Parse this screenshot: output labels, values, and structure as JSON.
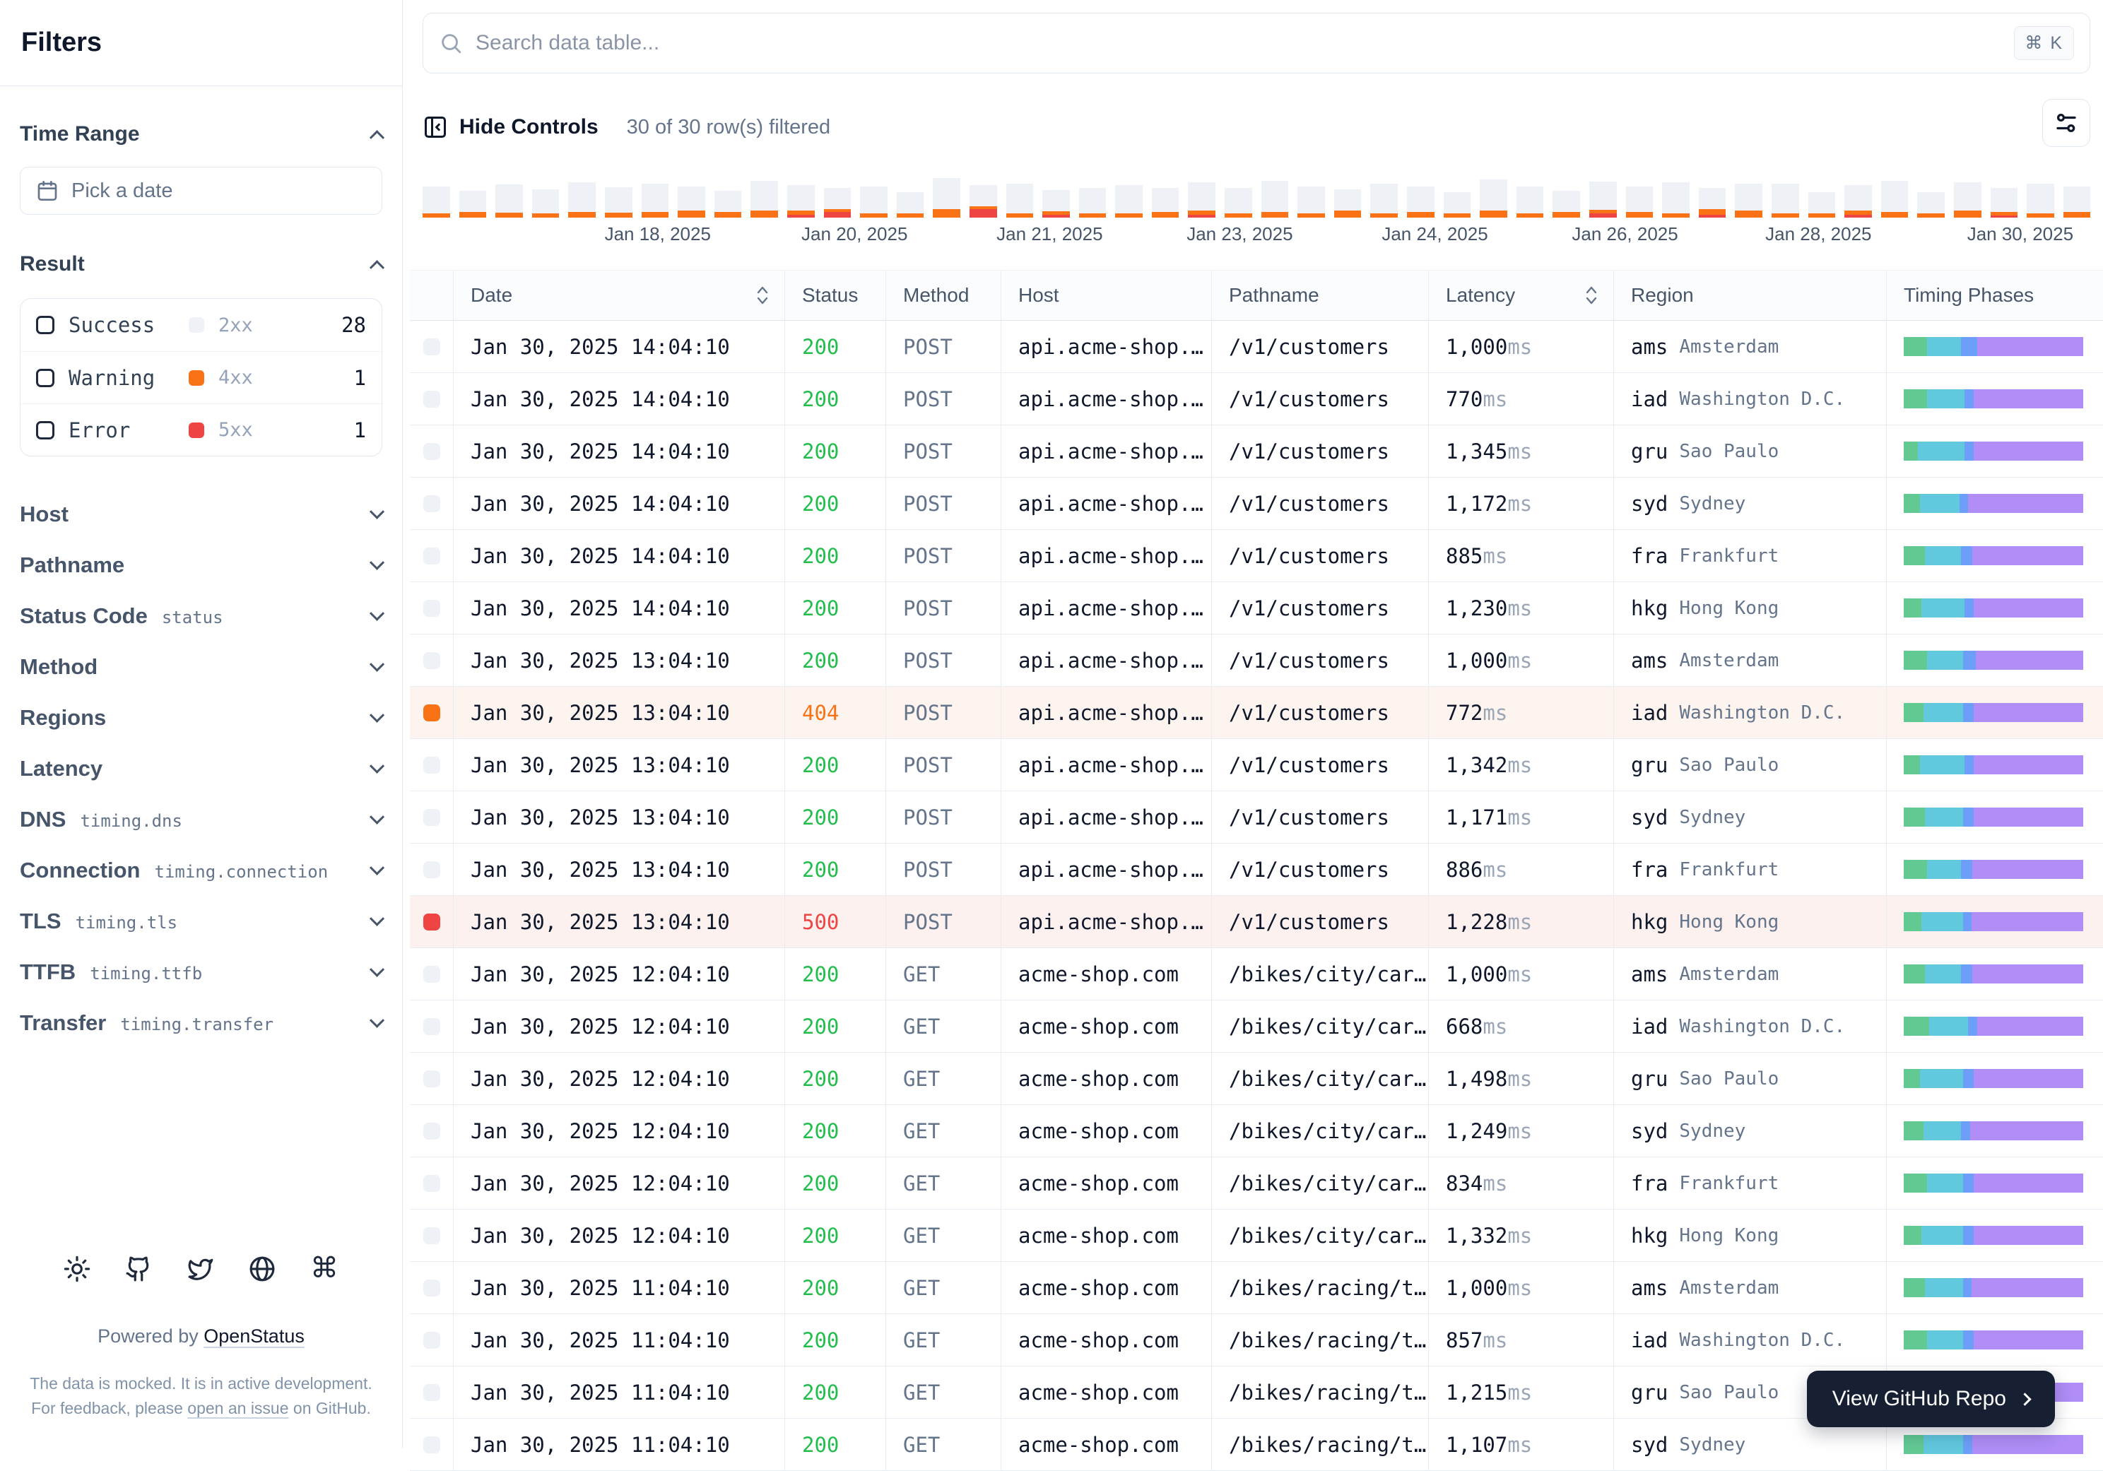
{
  "colors": {
    "accent_orange": "#f97316",
    "accent_red": "#ef4444",
    "success_green": "#23bd4e",
    "bar_gray": "#eef2f6",
    "timing_dns": "#62c993",
    "timing_connection": "#62c8dd",
    "timing_tls": "#6d9ff8",
    "timing_ttfb": "#b08df7",
    "warn_row_bg": "#fdf3ef",
    "err_row_bg": "#fdf1f0"
  },
  "sidebar": {
    "title": "Filters",
    "time_range": {
      "label": "Time Range",
      "picker_label": "Pick a date"
    },
    "result": {
      "label": "Result",
      "options": [
        {
          "label": "Success",
          "code": "2xx",
          "count": "28",
          "color": "#eef2f6"
        },
        {
          "label": "Warning",
          "code": "4xx",
          "count": "1",
          "color": "#f97316"
        },
        {
          "label": "Error",
          "code": "5xx",
          "count": "1",
          "color": "#ef4444"
        }
      ]
    },
    "filters": [
      {
        "label": "Host",
        "code": ""
      },
      {
        "label": "Pathname",
        "code": ""
      },
      {
        "label": "Status Code",
        "code": "status"
      },
      {
        "label": "Method",
        "code": ""
      },
      {
        "label": "Regions",
        "code": ""
      },
      {
        "label": "Latency",
        "code": ""
      },
      {
        "label": "DNS",
        "code": "timing.dns"
      },
      {
        "label": "Connection",
        "code": "timing.connection"
      },
      {
        "label": "TLS",
        "code": "timing.tls"
      },
      {
        "label": "TTFB",
        "code": "timing.ttfb"
      },
      {
        "label": "Transfer",
        "code": "timing.transfer"
      }
    ],
    "footer": {
      "icons": [
        "sun-icon",
        "github-icon",
        "twitter-icon",
        "globe-icon",
        "command-icon"
      ],
      "powered_by": "Powered by",
      "brand_link": "OpenStatus",
      "note_before": "The data is mocked. It is in active development. For feedback, please ",
      "note_link": "open an issue",
      "note_after": " on GitHub."
    }
  },
  "search": {
    "placeholder": "Search data table...",
    "shortcut": "⌘ K"
  },
  "controls": {
    "hide_label": "Hide Controls",
    "filtered_text": "30 of 30 row(s) filtered"
  },
  "chart_data": {
    "type": "bar",
    "stacked": true,
    "title": "Requests over time histogram",
    "legend_position": "none",
    "grid": false,
    "x_ticks": [
      "Jan 18, 2025",
      "Jan 20, 2025",
      "Jan 21, 2025",
      "Jan 23, 2025",
      "Jan 24, 2025",
      "Jan 26, 2025",
      "Jan 28, 2025",
      "Jan 30, 2025"
    ],
    "tick_pos_pct": [
      14.1,
      25.9,
      37.6,
      49.0,
      60.7,
      72.1,
      83.7,
      95.8
    ],
    "series_names": [
      "success_gray",
      "4xx_orange",
      "5xx_red"
    ],
    "bars": [
      [
        38,
        6,
        0
      ],
      [
        30,
        8,
        0
      ],
      [
        40,
        7,
        0
      ],
      [
        34,
        6,
        0
      ],
      [
        42,
        8,
        0
      ],
      [
        36,
        7,
        0
      ],
      [
        40,
        8,
        0
      ],
      [
        34,
        10,
        0
      ],
      [
        30,
        8,
        0
      ],
      [
        42,
        10,
        0
      ],
      [
        36,
        6,
        4
      ],
      [
        30,
        4,
        8
      ],
      [
        38,
        6,
        0
      ],
      [
        30,
        6,
        0
      ],
      [
        44,
        12,
        0
      ],
      [
        30,
        4,
        12
      ],
      [
        42,
        6,
        0
      ],
      [
        30,
        5,
        4
      ],
      [
        36,
        6,
        0
      ],
      [
        40,
        6,
        0
      ],
      [
        34,
        8,
        0
      ],
      [
        40,
        6,
        4
      ],
      [
        36,
        6,
        0
      ],
      [
        44,
        8,
        0
      ],
      [
        38,
        6,
        0
      ],
      [
        30,
        10,
        0
      ],
      [
        42,
        6,
        0
      ],
      [
        36,
        8,
        0
      ],
      [
        30,
        6,
        0
      ],
      [
        44,
        10,
        0
      ],
      [
        38,
        6,
        0
      ],
      [
        30,
        8,
        0
      ],
      [
        40,
        5,
        6
      ],
      [
        36,
        8,
        0
      ],
      [
        44,
        6,
        0
      ],
      [
        30,
        8,
        4
      ],
      [
        38,
        10,
        0
      ],
      [
        42,
        6,
        0
      ],
      [
        30,
        6,
        0
      ],
      [
        36,
        6,
        4
      ],
      [
        44,
        8,
        0
      ],
      [
        30,
        6,
        0
      ],
      [
        40,
        10,
        0
      ],
      [
        34,
        5,
        3
      ],
      [
        42,
        6,
        0
      ],
      [
        36,
        8,
        0
      ]
    ]
  },
  "table": {
    "columns": [
      {
        "label": "",
        "sortable": false
      },
      {
        "label": "Date",
        "sortable": true
      },
      {
        "label": "Status",
        "sortable": false
      },
      {
        "label": "Method",
        "sortable": false
      },
      {
        "label": "Host",
        "sortable": false
      },
      {
        "label": "Pathname",
        "sortable": false
      },
      {
        "label": "Latency",
        "sortable": true
      },
      {
        "label": "Region",
        "sortable": false
      },
      {
        "label": "Timing Phases",
        "sortable": false
      }
    ],
    "latency_unit": "ms",
    "rows": [
      {
        "date": "Jan 30, 2025 14:04:10",
        "status": "200",
        "level": "ok",
        "method": "POST",
        "host": "api.acme-shop.…",
        "pathname": "/v1/customers",
        "latency": "1,000",
        "region_code": "ams",
        "region_city": "Amsterdam",
        "timing": [
          13,
          19,
          9,
          59
        ]
      },
      {
        "date": "Jan 30, 2025 14:04:10",
        "status": "200",
        "level": "ok",
        "method": "POST",
        "host": "api.acme-shop.…",
        "pathname": "/v1/customers",
        "latency": "770",
        "region_code": "iad",
        "region_city": "Washington D.C.",
        "timing": [
          13,
          21,
          5,
          61
        ]
      },
      {
        "date": "Jan 30, 2025 14:04:10",
        "status": "200",
        "level": "ok",
        "method": "POST",
        "host": "api.acme-shop.…",
        "pathname": "/v1/customers",
        "latency": "1,345",
        "region_code": "gru",
        "region_city": "Sao Paulo",
        "timing": [
          8,
          26,
          5,
          61
        ]
      },
      {
        "date": "Jan 30, 2025 14:04:10",
        "status": "200",
        "level": "ok",
        "method": "POST",
        "host": "api.acme-shop.…",
        "pathname": "/v1/customers",
        "latency": "1,172",
        "region_code": "syd",
        "region_city": "Sydney",
        "timing": [
          9,
          22,
          5,
          64
        ]
      },
      {
        "date": "Jan 30, 2025 14:04:10",
        "status": "200",
        "level": "ok",
        "method": "POST",
        "host": "api.acme-shop.…",
        "pathname": "/v1/customers",
        "latency": "885",
        "region_code": "fra",
        "region_city": "Frankfurt",
        "timing": [
          12,
          20,
          6,
          62
        ]
      },
      {
        "date": "Jan 30, 2025 14:04:10",
        "status": "200",
        "level": "ok",
        "method": "POST",
        "host": "api.acme-shop.…",
        "pathname": "/v1/customers",
        "latency": "1,230",
        "region_code": "hkg",
        "region_city": "Hong Kong",
        "timing": [
          10,
          24,
          5,
          61
        ]
      },
      {
        "date": "Jan 30, 2025 13:04:10",
        "status": "200",
        "level": "ok",
        "method": "POST",
        "host": "api.acme-shop.…",
        "pathname": "/v1/customers",
        "latency": "1,000",
        "region_code": "ams",
        "region_city": "Amsterdam",
        "timing": [
          13,
          20,
          7,
          60
        ]
      },
      {
        "date": "Jan 30, 2025 13:04:10",
        "status": "404",
        "level": "warn",
        "method": "POST",
        "host": "api.acme-shop.…",
        "pathname": "/v1/customers",
        "latency": "772",
        "region_code": "iad",
        "region_city": "Washington D.C.",
        "timing": [
          11,
          22,
          6,
          61
        ]
      },
      {
        "date": "Jan 30, 2025 13:04:10",
        "status": "200",
        "level": "ok",
        "method": "POST",
        "host": "api.acme-shop.…",
        "pathname": "/v1/customers",
        "latency": "1,342",
        "region_code": "gru",
        "region_city": "Sao Paulo",
        "timing": [
          9,
          25,
          5,
          61
        ]
      },
      {
        "date": "Jan 30, 2025 13:04:10",
        "status": "200",
        "level": "ok",
        "method": "POST",
        "host": "api.acme-shop.…",
        "pathname": "/v1/customers",
        "latency": "1,171",
        "region_code": "syd",
        "region_city": "Sydney",
        "timing": [
          12,
          21,
          6,
          61
        ]
      },
      {
        "date": "Jan 30, 2025 13:04:10",
        "status": "200",
        "level": "ok",
        "method": "POST",
        "host": "api.acme-shop.…",
        "pathname": "/v1/customers",
        "latency": "886",
        "region_code": "fra",
        "region_city": "Frankfurt",
        "timing": [
          13,
          19,
          6,
          62
        ]
      },
      {
        "date": "Jan 30, 2025 13:04:10",
        "status": "500",
        "level": "err",
        "method": "POST",
        "host": "api.acme-shop.…",
        "pathname": "/v1/customers",
        "latency": "1,228",
        "region_code": "hkg",
        "region_city": "Hong Kong",
        "timing": [
          10,
          23,
          5,
          62
        ]
      },
      {
        "date": "Jan 30, 2025 12:04:10",
        "status": "200",
        "level": "ok",
        "method": "GET",
        "host": "acme-shop.com",
        "pathname": "/bikes/city/car…",
        "latency": "1,000",
        "region_code": "ams",
        "region_city": "Amsterdam",
        "timing": [
          12,
          20,
          6,
          62
        ]
      },
      {
        "date": "Jan 30, 2025 12:04:10",
        "status": "200",
        "level": "ok",
        "method": "GET",
        "host": "acme-shop.com",
        "pathname": "/bikes/city/car…",
        "latency": "668",
        "region_code": "iad",
        "region_city": "Washington D.C.",
        "timing": [
          14,
          22,
          5,
          59
        ]
      },
      {
        "date": "Jan 30, 2025 12:04:10",
        "status": "200",
        "level": "ok",
        "method": "GET",
        "host": "acme-shop.com",
        "pathname": "/bikes/city/car…",
        "latency": "1,498",
        "region_code": "gru",
        "region_city": "Sao Paulo",
        "timing": [
          9,
          24,
          6,
          61
        ]
      },
      {
        "date": "Jan 30, 2025 12:04:10",
        "status": "200",
        "level": "ok",
        "method": "GET",
        "host": "acme-shop.com",
        "pathname": "/bikes/city/car…",
        "latency": "1,249",
        "region_code": "syd",
        "region_city": "Sydney",
        "timing": [
          11,
          21,
          5,
          63
        ]
      },
      {
        "date": "Jan 30, 2025 12:04:10",
        "status": "200",
        "level": "ok",
        "method": "GET",
        "host": "acme-shop.com",
        "pathname": "/bikes/city/car…",
        "latency": "834",
        "region_code": "fra",
        "region_city": "Frankfurt",
        "timing": [
          13,
          20,
          6,
          61
        ]
      },
      {
        "date": "Jan 30, 2025 12:04:10",
        "status": "200",
        "level": "ok",
        "method": "GET",
        "host": "acme-shop.com",
        "pathname": "/bikes/city/car…",
        "latency": "1,332",
        "region_code": "hkg",
        "region_city": "Hong Kong",
        "timing": [
          10,
          23,
          6,
          61
        ]
      },
      {
        "date": "Jan 30, 2025 11:04:10",
        "status": "200",
        "level": "ok",
        "method": "GET",
        "host": "acme-shop.com",
        "pathname": "/bikes/racing/t…",
        "latency": "1,000",
        "region_code": "ams",
        "region_city": "Amsterdam",
        "timing": [
          12,
          21,
          5,
          62
        ]
      },
      {
        "date": "Jan 30, 2025 11:04:10",
        "status": "200",
        "level": "ok",
        "method": "GET",
        "host": "acme-shop.com",
        "pathname": "/bikes/racing/t…",
        "latency": "857",
        "region_code": "iad",
        "region_city": "Washington D.C.",
        "timing": [
          13,
          20,
          6,
          61
        ]
      },
      {
        "date": "Jan 30, 2025 11:04:10",
        "status": "200",
        "level": "ok",
        "method": "GET",
        "host": "acme-shop.com",
        "pathname": "/bikes/racing/t…",
        "latency": "1,215",
        "region_code": "gru",
        "region_city": "Sao Paulo",
        "timing": [
          9,
          24,
          5,
          62
        ]
      },
      {
        "date": "Jan 30, 2025 11:04:10",
        "status": "200",
        "level": "ok",
        "method": "GET",
        "host": "acme-shop.com",
        "pathname": "/bikes/racing/t…",
        "latency": "1,107",
        "region_code": "syd",
        "region_city": "Sydney",
        "timing": [
          11,
          22,
          5,
          62
        ]
      }
    ]
  },
  "github_button": {
    "label": "View GitHub Repo"
  }
}
